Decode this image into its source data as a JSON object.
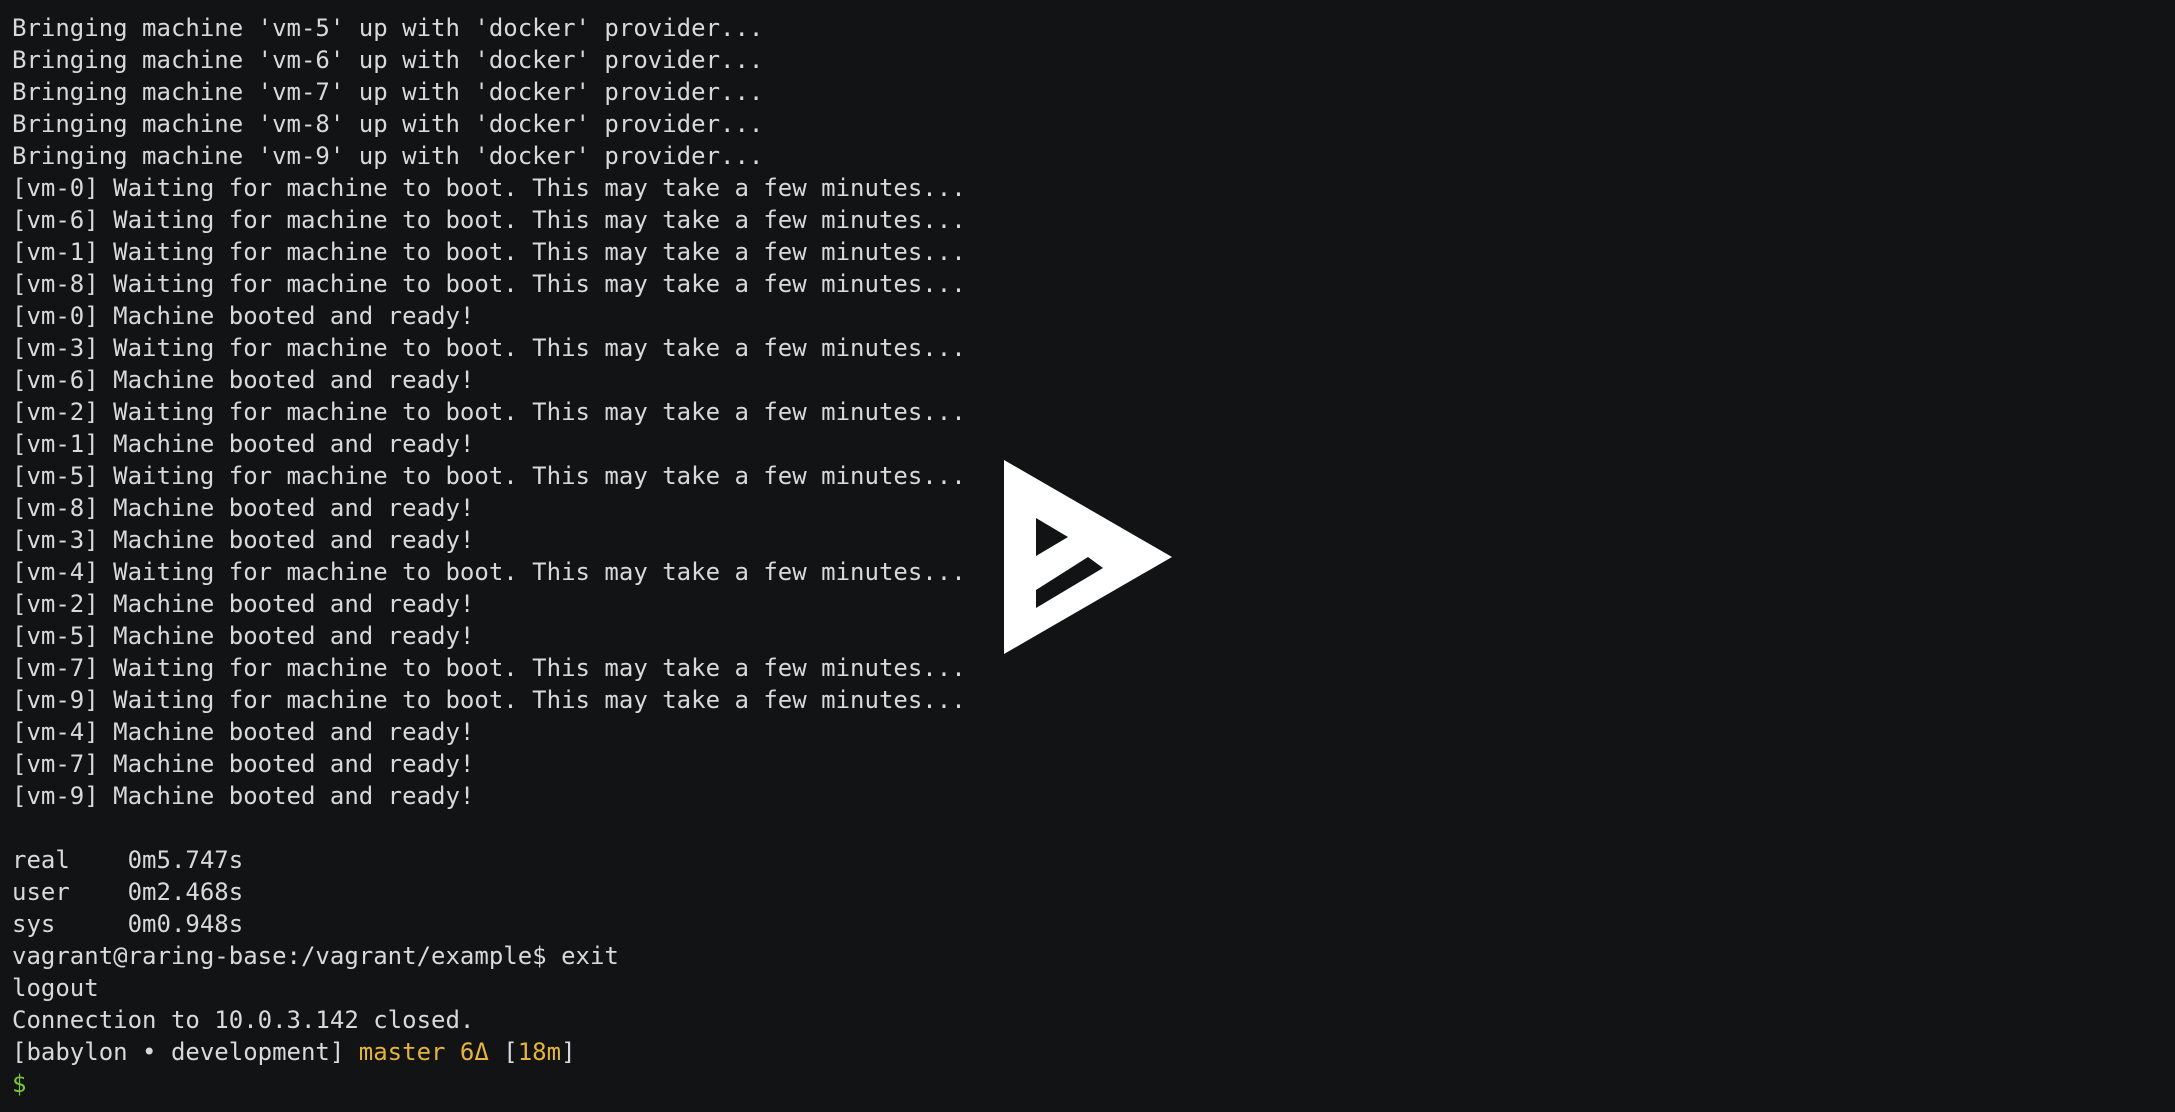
{
  "terminal": {
    "lines": [
      "Bringing machine 'vm-5' up with 'docker' provider...",
      "Bringing machine 'vm-6' up with 'docker' provider...",
      "Bringing machine 'vm-7' up with 'docker' provider...",
      "Bringing machine 'vm-8' up with 'docker' provider...",
      "Bringing machine 'vm-9' up with 'docker' provider...",
      "[vm-0] Waiting for machine to boot. This may take a few minutes...",
      "[vm-6] Waiting for machine to boot. This may take a few minutes...",
      "[vm-1] Waiting for machine to boot. This may take a few minutes...",
      "[vm-8] Waiting for machine to boot. This may take a few minutes...",
      "[vm-0] Machine booted and ready!",
      "[vm-3] Waiting for machine to boot. This may take a few minutes...",
      "[vm-6] Machine booted and ready!",
      "[vm-2] Waiting for machine to boot. This may take a few minutes...",
      "[vm-1] Machine booted and ready!",
      "[vm-5] Waiting for machine to boot. This may take a few minutes...",
      "[vm-8] Machine booted and ready!",
      "[vm-3] Machine booted and ready!",
      "[vm-4] Waiting for machine to boot. This may take a few minutes...",
      "[vm-2] Machine booted and ready!",
      "[vm-5] Machine booted and ready!",
      "[vm-7] Waiting for machine to boot. This may take a few minutes...",
      "[vm-9] Waiting for machine to boot. This may take a few minutes...",
      "[vm-4] Machine booted and ready!",
      "[vm-7] Machine booted and ready!",
      "[vm-9] Machine booted and ready!",
      "",
      "real    0m5.747s",
      "user    0m2.468s",
      "sys     0m0.948s",
      "vagrant@raring-base:/vagrant/example$ exit",
      "logout",
      "Connection to 10.0.3.142 closed."
    ],
    "prompt": {
      "context": "[babylon • development] ",
      "branch": "master 6Δ",
      "time_open": " [",
      "time": "18m",
      "time_close": "]",
      "symbol": "$"
    }
  },
  "overlay": {
    "icon": "asciinema-play-icon"
  },
  "colors": {
    "background": "#121314",
    "foreground": "#d9d9d9",
    "yellow": "#e6b43c",
    "green": "#7cc63a"
  }
}
